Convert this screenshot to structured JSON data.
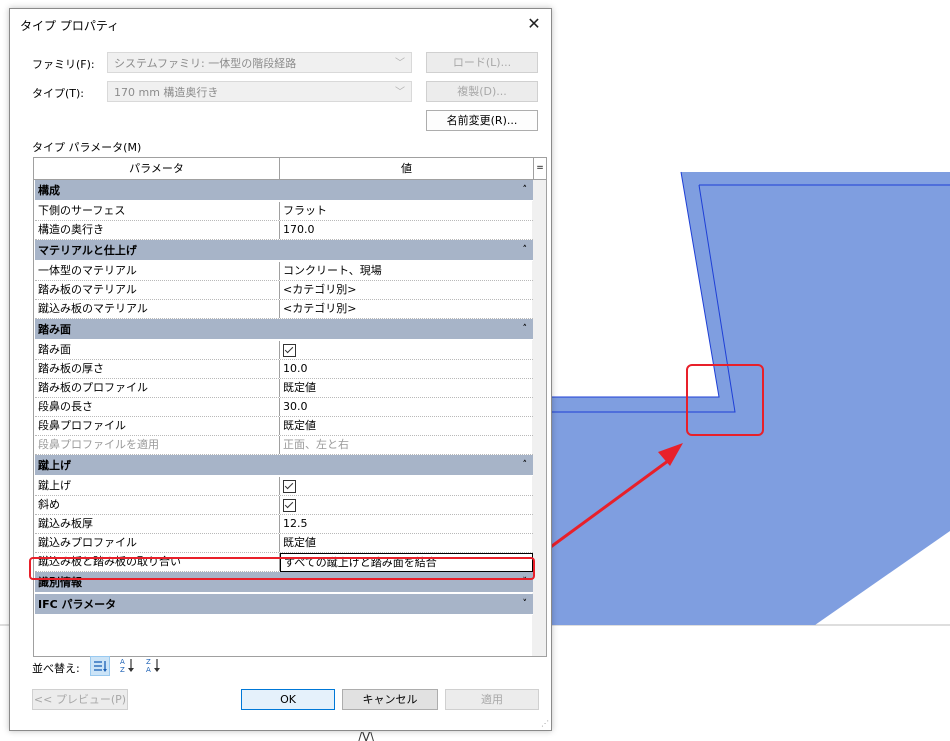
{
  "dialog": {
    "title": "タイプ プロパティ",
    "close_glyph": "✕",
    "family_label": "ファミリ(F):",
    "family_value": "システムファミリ: 一体型の階段経路",
    "type_label": "タイプ(T):",
    "type_value": "170 mm 構造奥行き",
    "load_button": "ロード(L)...",
    "duplicate_button": "複製(D)...",
    "rename_button": "名前変更(R)...",
    "type_params_label": "タイプ パラメータ(M)",
    "grid_header": {
      "param": "パラメータ",
      "value": "値",
      "sort_glyph": "="
    },
    "groups": [
      {
        "label": "構成",
        "rows": [
          {
            "name": "下側のサーフェス",
            "value": "フラット"
          },
          {
            "name": "構造の奥行き",
            "value": "170.0"
          }
        ]
      },
      {
        "label": "マテリアルと仕上げ",
        "rows": [
          {
            "name": "一体型のマテリアル",
            "value": "コンクリート、現場"
          },
          {
            "name": "踏み板のマテリアル",
            "value": "<カテゴリ別>"
          },
          {
            "name": "蹴込み板のマテリアル",
            "value": "<カテゴリ別>"
          }
        ]
      },
      {
        "label": "踏み面",
        "rows": [
          {
            "name": "踏み面",
            "value": ""
          },
          {
            "name": "踏み板の厚さ",
            "value": "10.0"
          },
          {
            "name": "踏み板のプロファイル",
            "value": "既定値"
          },
          {
            "name": "段鼻の長さ",
            "value": "30.0"
          },
          {
            "name": "段鼻プロファイル",
            "value": "既定値"
          },
          {
            "name": "段鼻プロファイルを適用",
            "value": "正面、左と右"
          }
        ]
      },
      {
        "label": "蹴上げ",
        "rows": [
          {
            "name": "蹴上げ",
            "value": ""
          },
          {
            "name": "斜め",
            "value": ""
          },
          {
            "name": "蹴込み板厚",
            "value": "12.5"
          },
          {
            "name": "蹴込みプロファイル",
            "value": "既定値"
          },
          {
            "name": "蹴込み板と踏み板の取り合い",
            "value": "すべての蹴上げと踏み面を結合"
          }
        ]
      },
      {
        "label": "識別情報",
        "rows": []
      },
      {
        "label": "IFC パラメータ",
        "rows": []
      }
    ],
    "collapse_glyph": "˄",
    "expand_glyph": "˅",
    "sort_label": "並べ替え:",
    "preview_button": "<< プレビュー(P)",
    "ok_button": "OK",
    "cancel_button": "キャンセル",
    "apply_button": "適用"
  },
  "canvas": {
    "fill_color": "#7f9ee0",
    "edge_color": "#1e3fd6",
    "highlight_color": "#e8202a",
    "bottom_label": "/V\\"
  }
}
